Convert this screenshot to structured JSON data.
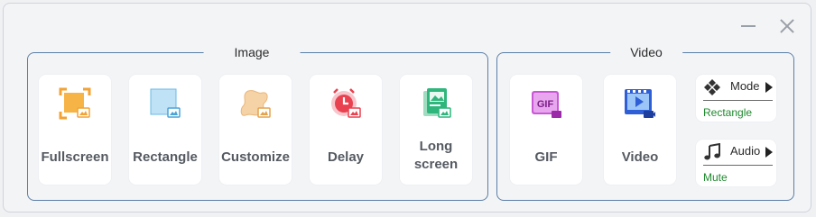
{
  "window_controls": {
    "minimize": "minimize",
    "close": "close"
  },
  "image_group": {
    "title": "Image",
    "tiles": [
      {
        "label": "Fullscreen",
        "icon": "fullscreen-capture-icon"
      },
      {
        "label": "Rectangle",
        "icon": "rectangle-capture-icon"
      },
      {
        "label": "Customize",
        "icon": "customize-capture-icon"
      },
      {
        "label": "Delay",
        "icon": "delay-capture-icon"
      },
      {
        "label_line1": "Long",
        "label_line2": "screen",
        "icon": "long-screen-capture-icon"
      }
    ]
  },
  "video_group": {
    "title": "Video",
    "tiles": [
      {
        "label": "GIF",
        "icon": "gif-record-icon"
      },
      {
        "label": "Video",
        "icon": "video-record-icon"
      }
    ],
    "options": {
      "mode": {
        "name": "Mode",
        "value": "Rectangle",
        "icon": "mode-icon"
      },
      "audio": {
        "name": "Audio",
        "value": "Mute",
        "icon": "music-note-icon"
      }
    }
  },
  "colors": {
    "group_border": "#5b7fa8",
    "tile_label": "#555a61",
    "option_value": "#1f8a2e"
  }
}
